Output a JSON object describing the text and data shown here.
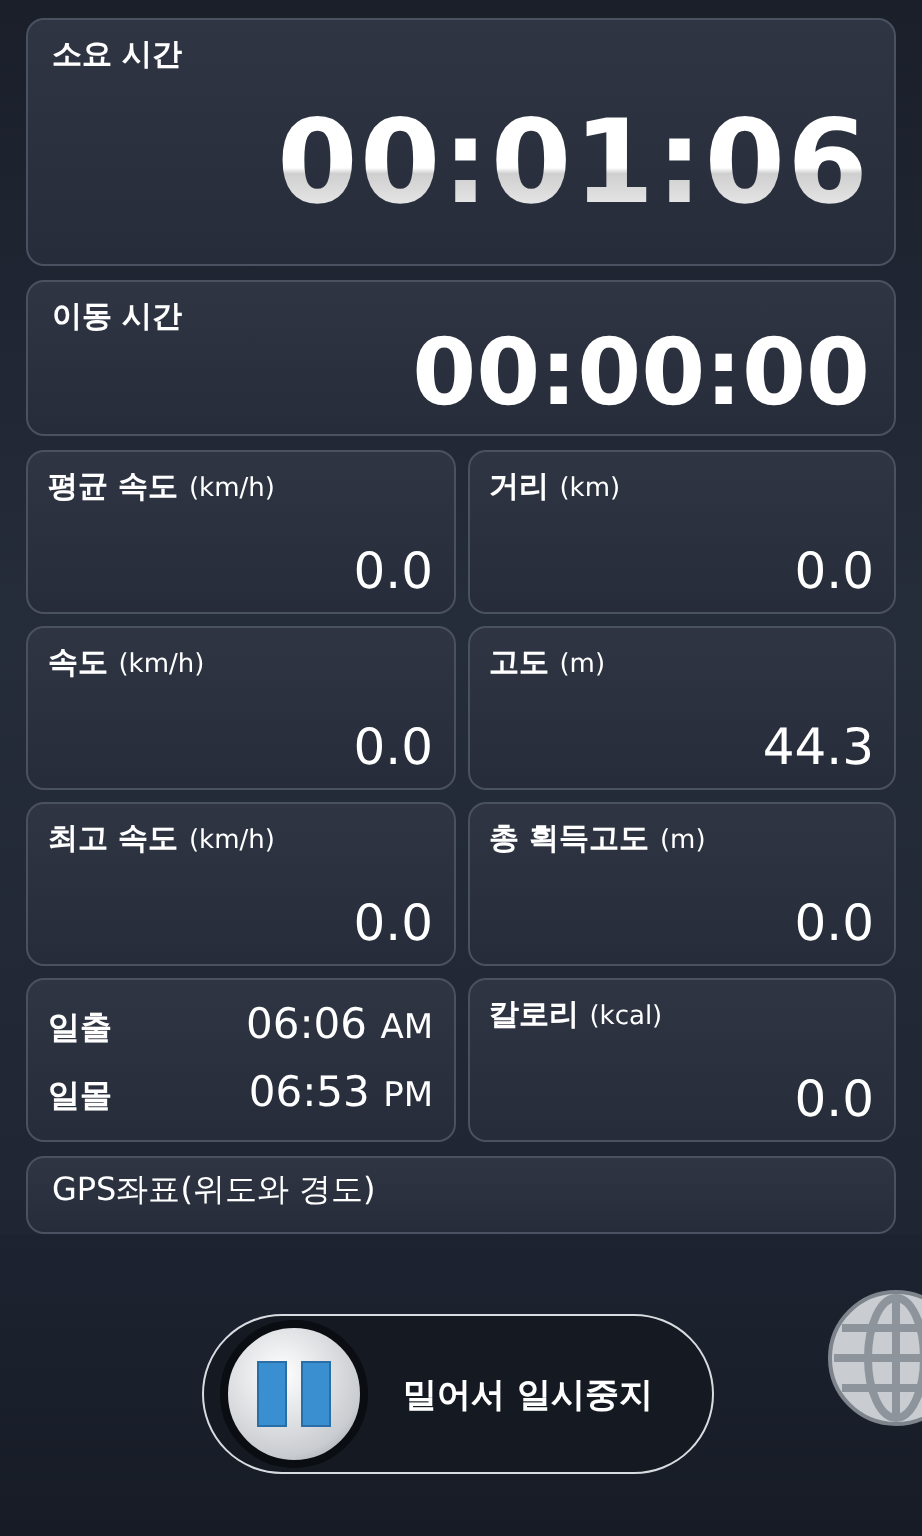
{
  "elapsed": {
    "label": "소요 시간",
    "value": "00:01:06"
  },
  "moving": {
    "label": "이동 시간",
    "value": "00:00:00"
  },
  "stats": [
    {
      "kind": "stat",
      "label": "평균 속도",
      "unit": "(km/h)",
      "value": "0.0"
    },
    {
      "kind": "stat",
      "label": "거리",
      "unit": "(km)",
      "value": "0.0"
    },
    {
      "kind": "stat",
      "label": "속도",
      "unit": "(km/h)",
      "value": "0.0"
    },
    {
      "kind": "stat",
      "label": "고도",
      "unit": "(m)",
      "value": "44.3"
    },
    {
      "kind": "stat",
      "label": "최고 속도",
      "unit": "(km/h)",
      "value": "0.0"
    },
    {
      "kind": "stat",
      "label": "총 획득고도",
      "unit": "(m)",
      "value": "0.0"
    },
    {
      "kind": "sun",
      "rows": [
        {
          "label": "일출",
          "time": "06:06",
          "ampm": "AM"
        },
        {
          "label": "일몰",
          "time": "06:53",
          "ampm": "PM"
        }
      ]
    },
    {
      "kind": "stat",
      "label": "칼로리",
      "unit": "(kcal)",
      "value": "0.0"
    }
  ],
  "gps": {
    "label": "GPS좌표(위도와 경도)"
  },
  "slider": {
    "label": "밀어서 일시중지",
    "level": 0
  }
}
